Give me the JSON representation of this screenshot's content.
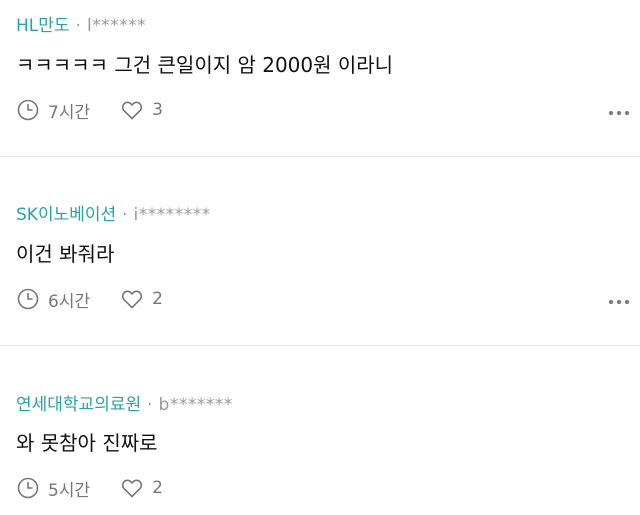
{
  "comments": [
    {
      "company": "HL만도",
      "separator": "·",
      "user": "l******",
      "text": "ㅋㅋㅋㅋㅋ 그건 큰일이지 암 2000원 이라니",
      "time": "7시간",
      "likes": "3"
    },
    {
      "company": "SK이노베이션",
      "separator": "·",
      "user": "i********",
      "text": "이건 봐줘라",
      "time": "6시간",
      "likes": "2"
    },
    {
      "company": "연세대학교의료원",
      "separator": "·",
      "user": "b*******",
      "text": "와 못참아 진짜로",
      "time": "5시간",
      "likes": "2"
    }
  ],
  "icons": {
    "time": "clock-icon",
    "likes": "heart-icon",
    "more": "more-options-icon"
  },
  "colors": {
    "company": "#2aa3a8",
    "muted": "#777777",
    "divider": "#e8e8e8"
  }
}
